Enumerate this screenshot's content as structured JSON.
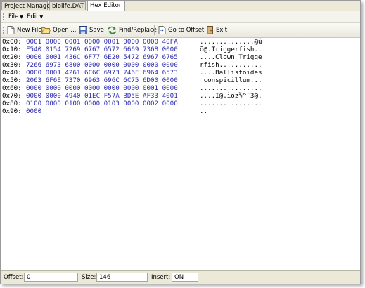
{
  "tabs": [
    {
      "label": "Project Manager"
    },
    {
      "label": "biolife.DAT"
    },
    {
      "label": "Hex Editor"
    }
  ],
  "menu": {
    "file": "File",
    "edit": "Edit"
  },
  "toolbar": {
    "new_file": "New File",
    "open": "Open ...",
    "save": "Save",
    "find_replace": "Find/Replace",
    "go_to_offset": "Go to Offset",
    "exit": "Exit"
  },
  "hex_rows": [
    {
      "offset": "0x00:",
      "hex": "0001 0000 0001 0000 0001 0000 0000 40FA",
      "ascii": "..............@ú"
    },
    {
      "offset": "0x10:",
      "hex": "F540 0154 7269 6767 6572 6669 7368 0000",
      "ascii": "õ@.Triggerfish.."
    },
    {
      "offset": "0x20:",
      "hex": "0000 0001 436C 6F77 6E20 5472 6967 6765",
      "ascii": "....Clown Trigge"
    },
    {
      "offset": "0x30:",
      "hex": "7266 6973 6800 0000 0000 0000 0000 0000",
      "ascii": "rfish..........."
    },
    {
      "offset": "0x40:",
      "hex": "0000 0001 4261 6C6C 6973 746F 6964 6573",
      "ascii": "....Ballistoides"
    },
    {
      "offset": "0x50:",
      "hex": "2063 6F6E 7370 6963 696C 6C75 6D00 0000",
      "ascii": " conspicillum..."
    },
    {
      "offset": "0x60:",
      "hex": "0000 0000 0000 0000 0000 0000 0001 0000",
      "ascii": "................"
    },
    {
      "offset": "0x70:",
      "hex": "0000 0000 4940 01EC F57A BD5E AF33 4001",
      "ascii": "....I@.ìõz½^¯3@."
    },
    {
      "offset": "0x80:",
      "hex": "0100 0000 0100 0000 0103 0000 0002 0000",
      "ascii": "................"
    },
    {
      "offset": "0x90:",
      "hex": "0000",
      "ascii": ".."
    }
  ],
  "status": {
    "offset_label": "Offset:",
    "offset_value": "0",
    "size_label": "Size:",
    "size_value": "146",
    "insert_label": "Insert:",
    "insert_value": "ON"
  },
  "colors": {
    "hex_text": "#2b2bb0",
    "chrome": "#ece9d8"
  },
  "icons": [
    "new-file-icon",
    "open-folder-icon",
    "save-icon",
    "find-replace-icon",
    "go-to-offset-icon",
    "exit-icon"
  ]
}
